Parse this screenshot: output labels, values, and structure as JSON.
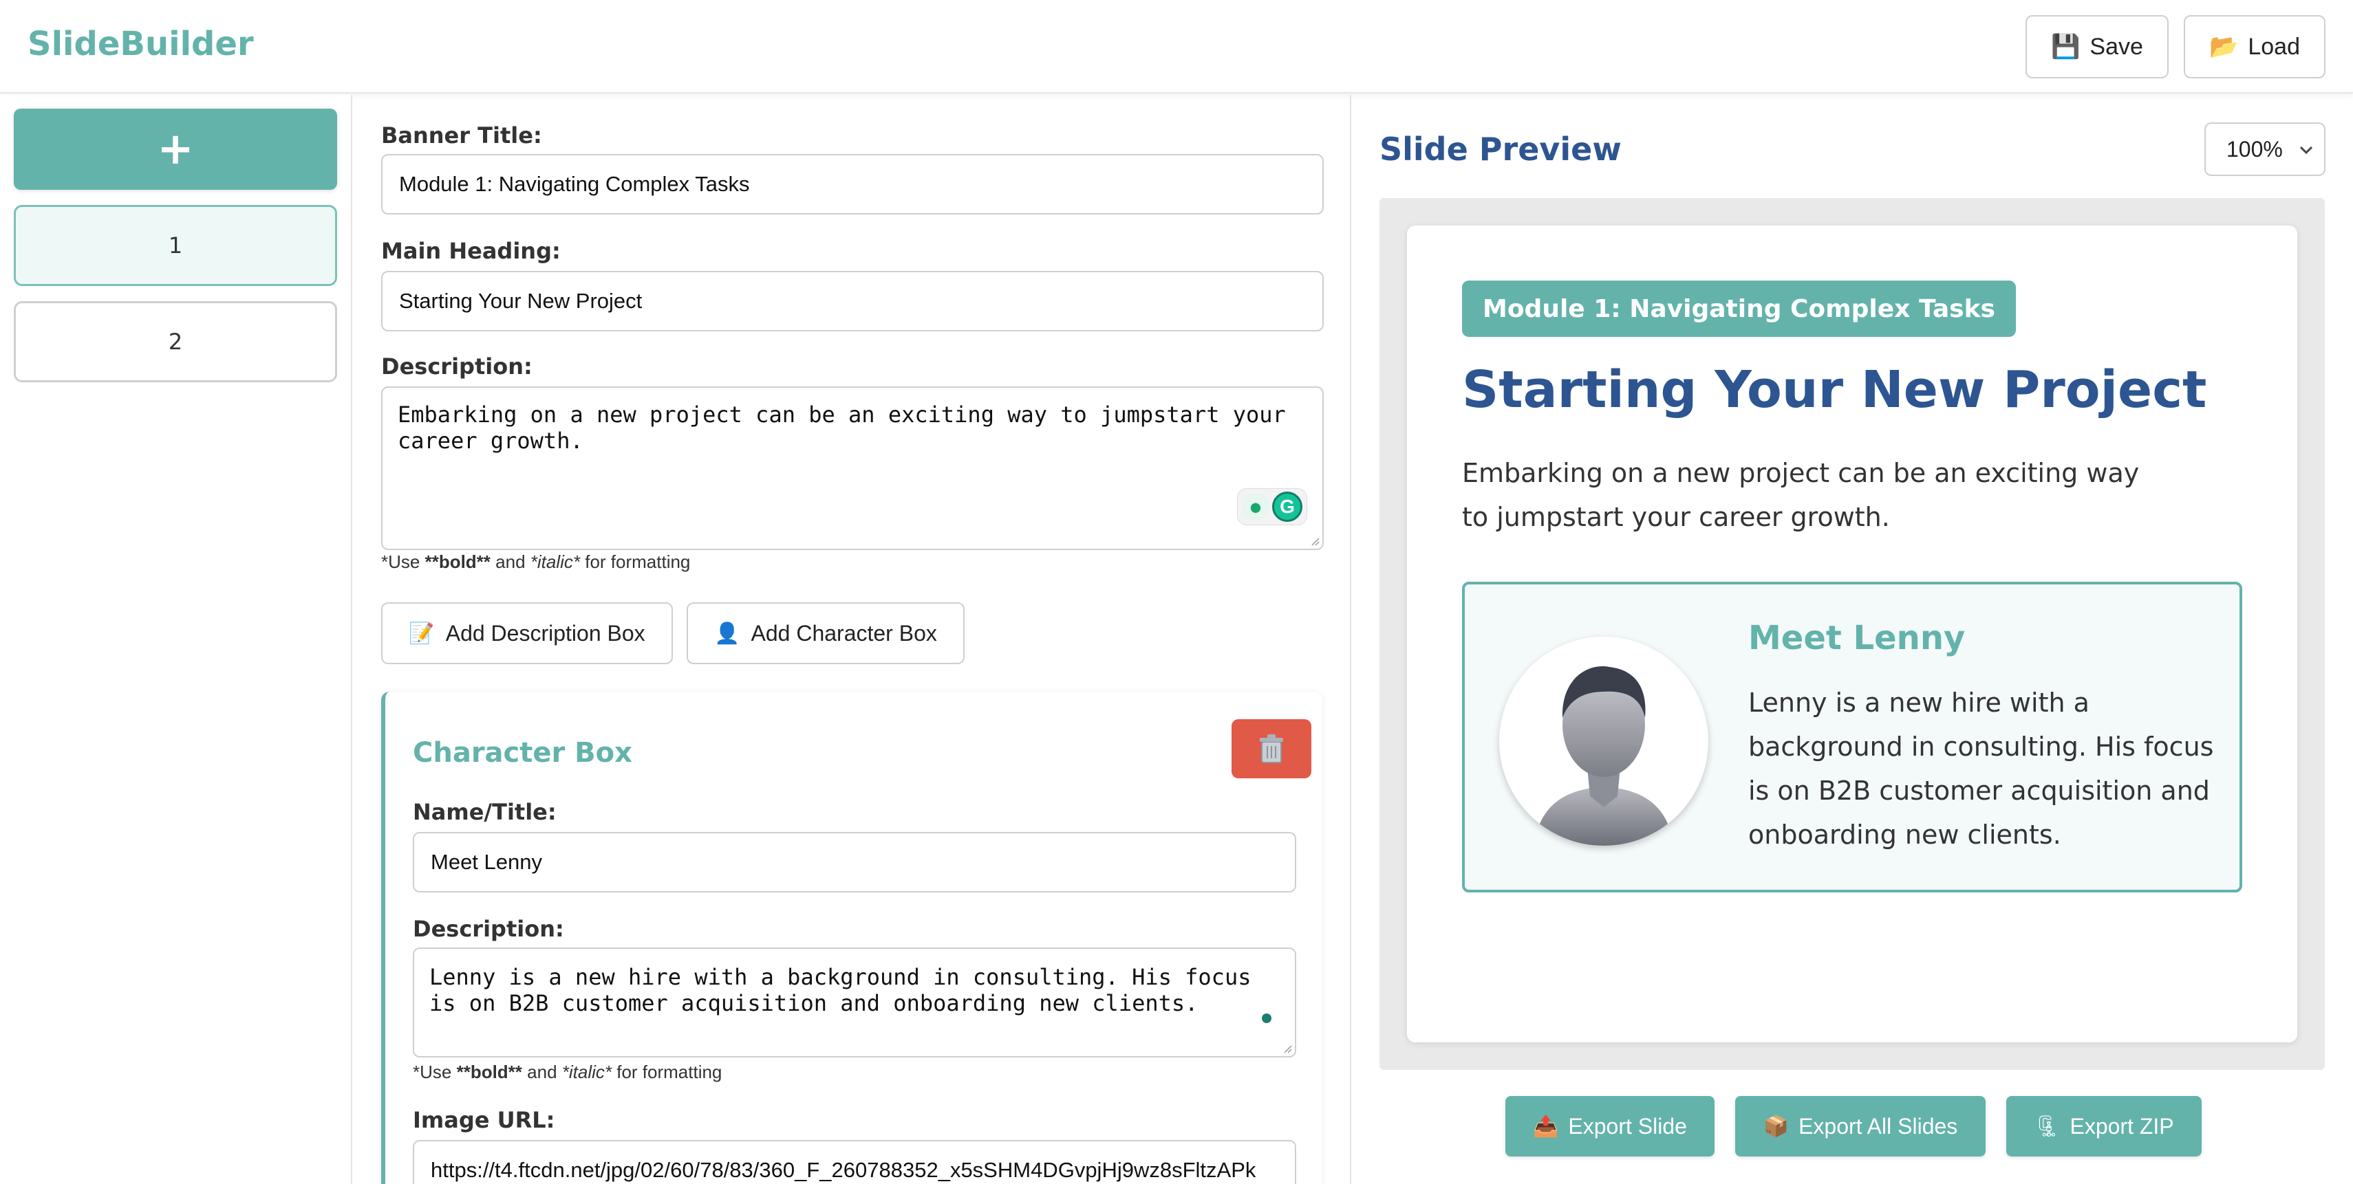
{
  "app": {
    "title": "SlideBuilder"
  },
  "header": {
    "save_label": "Save",
    "load_label": "Load",
    "save_icon": "💾",
    "load_icon": "📂"
  },
  "sidebar": {
    "add_label": "+",
    "slides": [
      {
        "label": "1",
        "active": true
      },
      {
        "label": "2",
        "active": false
      }
    ]
  },
  "editor": {
    "banner_label": "Banner Title:",
    "banner_value": "Module 1: Navigating Complex Tasks",
    "heading_label": "Main Heading:",
    "heading_value": "Starting Your New Project",
    "description_label": "Description:",
    "description_value": "Embarking on a new project can be an exciting way to jumpstart your career growth.",
    "hint_prefix": "*Use ",
    "hint_bold": "**bold**",
    "hint_mid": " and ",
    "hint_italic": "*italic*",
    "hint_suffix": " for formatting",
    "grammarly_label": "G",
    "add_description_label": "Add Description Box",
    "add_description_icon": "📝",
    "add_character_label": "Add Character Box",
    "add_character_icon": "👤",
    "character_box": {
      "title": "Character Box",
      "delete_icon": "trash-icon",
      "name_label": "Name/Title:",
      "name_value": "Meet Lenny",
      "description_label": "Description:",
      "description_value": "Lenny is a new hire with a background in consulting. His focus is on B2B customer acquisition and onboarding new clients.",
      "image_label": "Image URL:",
      "image_value": "https://t4.ftcdn.net/jpg/02/60/78/83/360_F_260788352_x5sSHM4DGvpjHj9wz8sFltzAPk"
    }
  },
  "preview": {
    "title": "Slide Preview",
    "zoom": "100%",
    "banner": "Module 1: Navigating Complex Tasks",
    "heading": "Starting Your New Project",
    "description": "Embarking on a new project can be an exciting way to jumpstart your career growth.",
    "character_name": "Meet Lenny",
    "character_description": "Lenny is a new hire with a background in consulting. His focus is on B2B customer acquisition and onboarding new clients."
  },
  "export": {
    "slide_label": "Export Slide",
    "all_label": "Export All Slides",
    "zip_label": "Export ZIP",
    "slide_icon": "📤",
    "all_icon": "📦",
    "zip_icon": "🗜"
  },
  "colors": {
    "accent": "#63b3ab",
    "heading_blue": "#2d5591",
    "danger": "#e05a47"
  }
}
